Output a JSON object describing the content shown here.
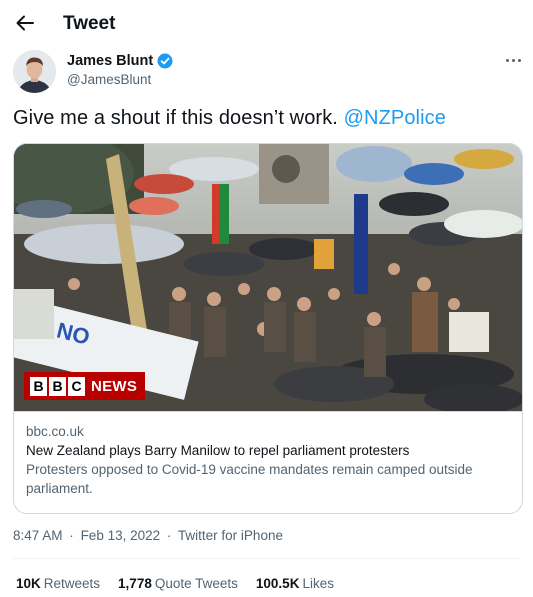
{
  "header": {
    "title": "Tweet",
    "back_icon": "arrow-left-icon"
  },
  "author": {
    "name": "James Blunt",
    "handle": "@JamesBlunt",
    "verified": true,
    "verified_color": "#1d9bf0"
  },
  "tweet": {
    "text": "Give me a shout if this doesn’t work.",
    "mention": "@NZPolice"
  },
  "card": {
    "badge_letters": [
      "B",
      "B",
      "C"
    ],
    "badge_text": "NEWS",
    "domain": "bbc.co.uk",
    "title": "New Zealand plays Barry Manilow to repel parliament protesters",
    "description": "Protesters opposed to Covid-19 vaccine mandates remain camped outside parliament."
  },
  "meta": {
    "time": "8:47 AM",
    "date": "Feb 13, 2022",
    "source": "Twitter for iPhone",
    "separator": "·"
  },
  "stats": {
    "retweets_count": "10K",
    "retweets_label": "Retweets",
    "quotes_count": "1,778",
    "quotes_label": "Quote Tweets",
    "likes_count": "100.5K",
    "likes_label": "Likes"
  },
  "colors": {
    "accent": "#1d9bf0",
    "bbc_red": "#b80000",
    "secondary_text": "#536471"
  }
}
